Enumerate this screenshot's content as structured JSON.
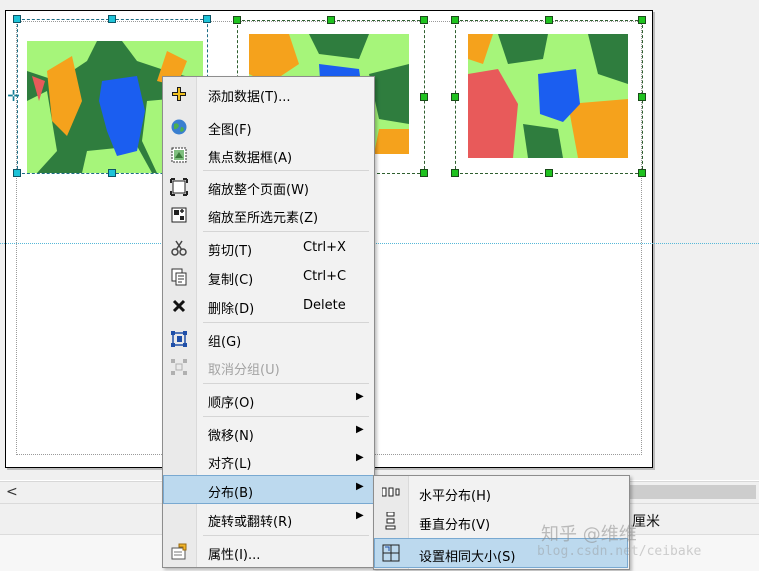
{
  "context_menu": {
    "items": [
      {
        "icon": "add-data-icon",
        "label": "添加数据(T)...",
        "shortcut": "",
        "submenu": false,
        "enabled": true
      },
      {
        "icon": "globe-icon",
        "label": "全图(F)",
        "shortcut": "",
        "submenu": false,
        "enabled": true
      },
      {
        "icon": "focus-data-frame-icon",
        "label": "焦点数据框(A)",
        "shortcut": "",
        "submenu": false,
        "enabled": true
      },
      {
        "icon": "zoom-whole-page-icon",
        "label": "缩放整个页面(W)",
        "shortcut": "",
        "submenu": false,
        "enabled": true
      },
      {
        "icon": "zoom-selected-elements-icon",
        "label": "缩放至所选元素(Z)",
        "shortcut": "",
        "submenu": false,
        "enabled": true
      },
      {
        "icon": "scissors-icon",
        "label": "剪切(T)",
        "shortcut": "Ctrl+X",
        "submenu": false,
        "enabled": true
      },
      {
        "icon": "copy-icon",
        "label": "复制(C)",
        "shortcut": "Ctrl+C",
        "submenu": false,
        "enabled": true
      },
      {
        "icon": "delete-x-icon",
        "label": "删除(D)",
        "shortcut": "Delete",
        "submenu": false,
        "enabled": true
      },
      {
        "icon": "group-icon",
        "label": "组(G)",
        "shortcut": "",
        "submenu": false,
        "enabled": true
      },
      {
        "icon": "ungroup-icon",
        "label": "取消分组(U)",
        "shortcut": "",
        "submenu": false,
        "enabled": false
      },
      {
        "icon": "",
        "label": "顺序(O)",
        "shortcut": "",
        "submenu": true,
        "enabled": true
      },
      {
        "icon": "",
        "label": "微移(N)",
        "shortcut": "",
        "submenu": true,
        "enabled": true
      },
      {
        "icon": "",
        "label": "对齐(L)",
        "shortcut": "",
        "submenu": true,
        "enabled": true
      },
      {
        "icon": "",
        "label": "分布(B)",
        "shortcut": "",
        "submenu": true,
        "enabled": true,
        "highlighted": true
      },
      {
        "icon": "",
        "label": "旋转或翻转(R)",
        "shortcut": "",
        "submenu": true,
        "enabled": true
      },
      {
        "icon": "properties-icon",
        "label": "属性(I)...",
        "shortcut": "",
        "submenu": false,
        "enabled": true
      }
    ]
  },
  "distribute_submenu": {
    "items": [
      {
        "icon": "distribute-horizontally-icon",
        "label": "水平分布(H)"
      },
      {
        "icon": "distribute-vertically-icon",
        "label": "垂直分布(V)"
      },
      {
        "icon": "make-same-size-icon",
        "label": "设置相同大小(S)",
        "highlighted": true
      }
    ]
  },
  "status_bar": {
    "unit": "厘米"
  },
  "watermark": {
    "text": "知乎 @维维",
    "subtext": "blog.csdn.net/ceibake"
  },
  "colors": {
    "map_dark_green": "#2f7d3e",
    "map_light_green": "#a6f57a",
    "map_orange": "#f5a21c",
    "map_red": "#e85a5a",
    "map_water_blue": "#1b5ef0",
    "selection_handle_green": "#1fc21f",
    "selection_handle_cyan": "#1ec3d8",
    "menu_highlight": "#bcd9ee"
  }
}
